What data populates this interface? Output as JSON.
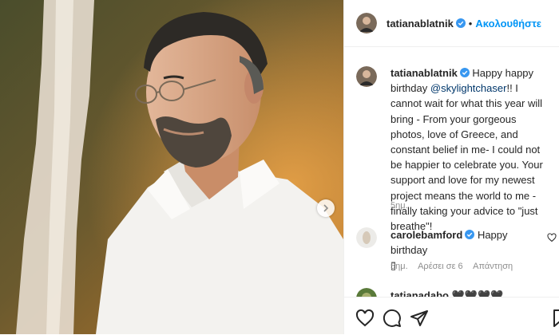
{
  "header": {
    "username": "tatianablatnik",
    "separator": "•",
    "follow_label": "Ακολουθήστε"
  },
  "caption": {
    "username": "tatianablatnik",
    "text_before": "Happy happy birthday ",
    "mention": "@skylightchaser",
    "text_after": "!! I cannot wait for what this year will bring - From your gorgeous photos, love of Greece, and constant belief in me- I could not be happier to celebrate you. Your support and love for my newest project means the world to me - finally taking your advice to \"just breathe\"!",
    "time": "5ημ."
  },
  "comments": [
    {
      "username": "carolebamford",
      "text": "Happy birthday",
      "emoji": "▯",
      "time": "5ημ.",
      "likes": "Αρέσει σε 6",
      "reply": "Απάντηση"
    },
    {
      "username": "tatianadabo",
      "text": "🖤🖤🖤🖤"
    }
  ],
  "icons": {
    "verified_color": "#3897f0",
    "link_color": "#0095f6"
  }
}
